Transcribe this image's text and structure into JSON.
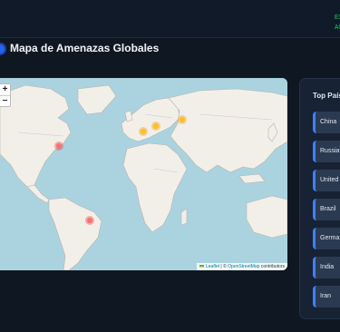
{
  "header": {
    "status_1": "ES",
    "status_2": "AC"
  },
  "page": {
    "title": "Mapa de Amenazas Globales",
    "title_icon": "globe-icon"
  },
  "map": {
    "zoom_in_label": "+",
    "zoom_out_label": "−",
    "attribution": {
      "leaflet": "Leaflet",
      "sep": "| ©",
      "osm": "OpenStreetMap",
      "suffix": "contributors"
    },
    "markers": [
      {
        "label": "United States",
        "color": "red"
      },
      {
        "label": "Brazil",
        "color": "red"
      },
      {
        "label": "Germany",
        "color": "orange"
      },
      {
        "label": "Europe North",
        "color": "orange"
      },
      {
        "label": "Europe East",
        "color": "orange"
      }
    ]
  },
  "top_countries": {
    "title": "Top Países",
    "items": [
      "China",
      "Russia",
      "United",
      "Brazil",
      "Germa",
      "India",
      "Iran"
    ]
  },
  "colors": {
    "background": "#0f1722",
    "accent": "#3b82f6",
    "ocean": "#aad3df",
    "land": "#f2efe9"
  }
}
